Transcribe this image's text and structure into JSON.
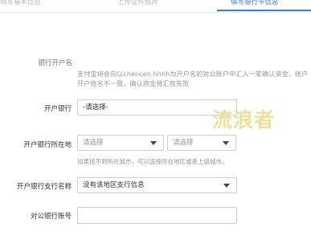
{
  "steps": [
    {
      "label": "填写基本信息",
      "active": false
    },
    {
      "label": "上传证件照片",
      "active": false
    },
    {
      "label": "填写银行卡信息",
      "active": true
    }
  ],
  "form": {
    "account_name": {
      "label": "银行开户名",
      "value": "",
      "notice": "支付宝将会向以chencen hhhh为开户名的对公账户中汇入一笔确认资金，账户开户姓名不一致，确认资金将汇款失败"
    },
    "bank": {
      "label": "开户银行",
      "value": "-请选择-"
    },
    "location": {
      "label": "开户银行所在地",
      "province_placeholder": "请选择",
      "city_placeholder": "请选择",
      "hint": "如果找不到所在城市，可以选择所在地区或者上级城市。"
    },
    "branch": {
      "label": "开户银行支行名称",
      "value": "没有该地区支行信息"
    },
    "account_number": {
      "label": "对公银行账号",
      "value": ""
    }
  },
  "watermark": "流浪者",
  "colors": {
    "accent": "#3a7bd5",
    "watermark": "#f0d98a"
  }
}
